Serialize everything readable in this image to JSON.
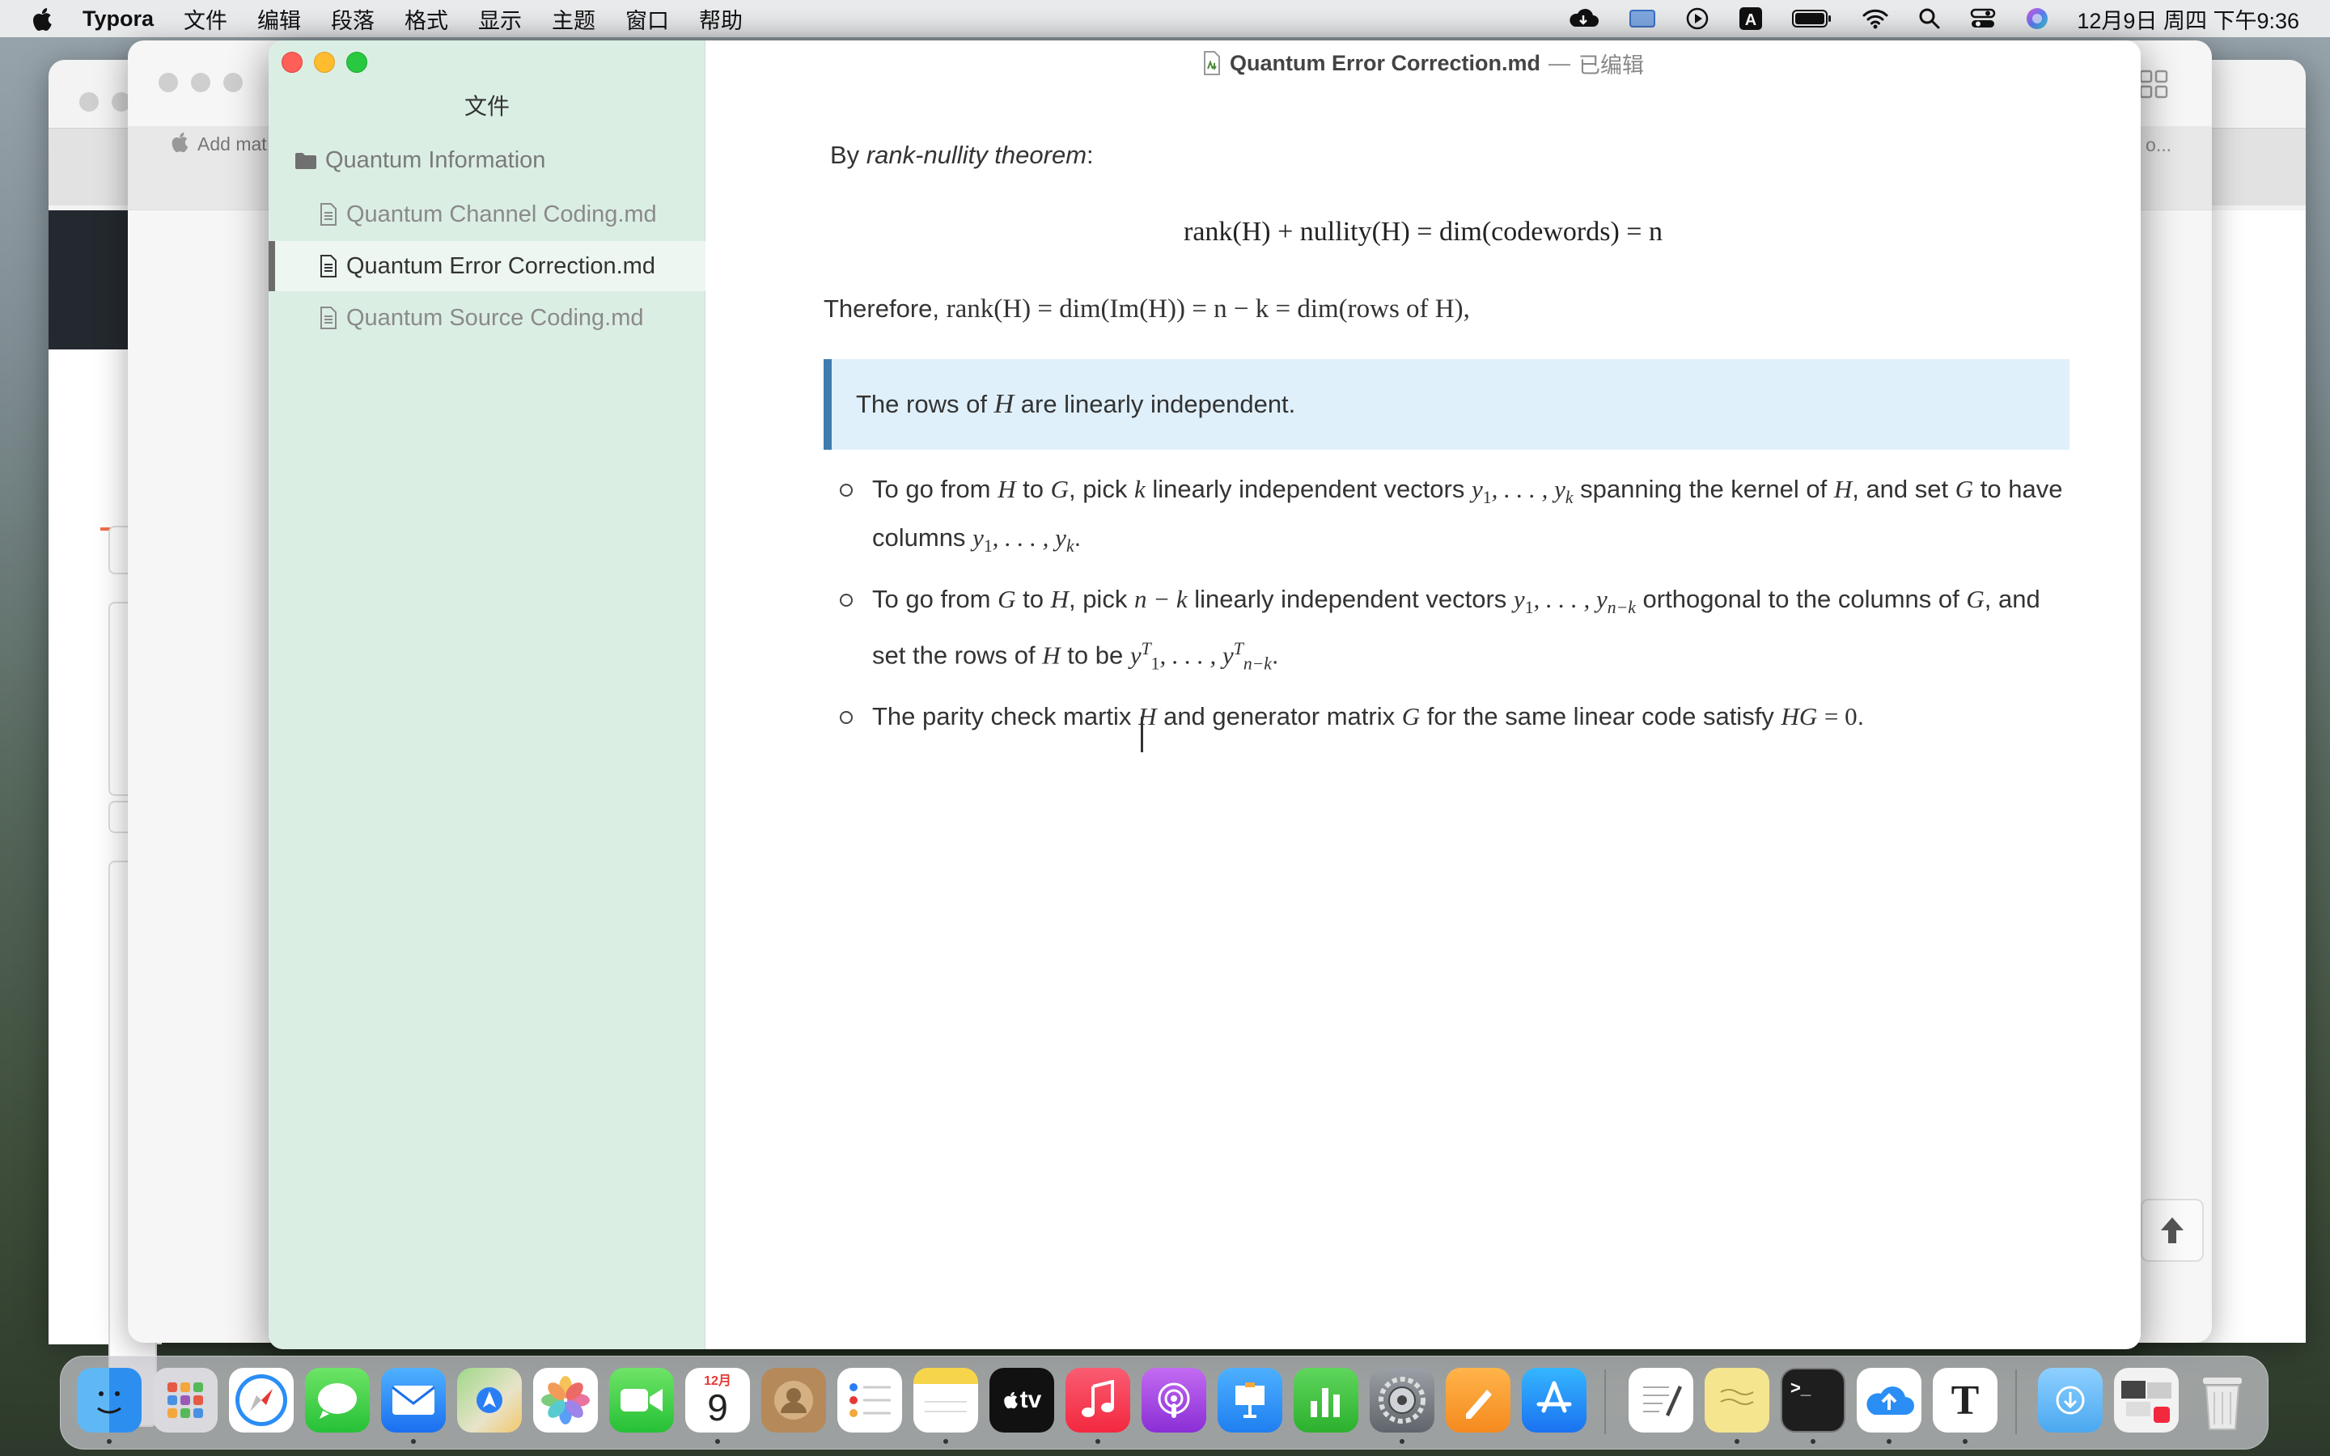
{
  "menubar": {
    "apple_icon": "apple-logo",
    "items": [
      "Typora",
      "文件",
      "编辑",
      "段落",
      "格式",
      "显示",
      "主题",
      "窗口",
      "帮助"
    ],
    "clock": "12月9日 周四 下午9:36",
    "status_icons": [
      "cloud-icon",
      "screen-icon",
      "play-icon",
      "input-method-icon",
      "battery-icon",
      "wifi-icon",
      "search-icon",
      "control-center-icon",
      "siri-icon"
    ],
    "input_method_label": "A"
  },
  "background_windows": {
    "browser_tab_text": "Add mat",
    "right_tab_text": "o..."
  },
  "typora": {
    "title_file": "Quantum Error Correction.md",
    "title_sep": "—",
    "title_state": "已编辑",
    "sidebar": {
      "title": "文件",
      "folder": "Quantum Information",
      "files": [
        "Quantum Channel Coding.md",
        "Quantum Error Correction.md",
        "Quantum Source Coding.md"
      ],
      "active_index": 1
    },
    "content": {
      "by": "By",
      "theorem": "rank-nullity theorem",
      "colon": ":",
      "display_eq": "rank(H) + nullity(H) = dim(codewords) = n",
      "therefore_prefix": "Therefore,",
      "therefore_eq": "rank(H) = dim(Im(H)) = n − k = dim(rows of H),",
      "blockquote_prefix": "The rows of",
      "blockquote_var": "H",
      "blockquote_suffix": "are linearly independent.",
      "bullets": [
        {
          "t1": "To go from",
          "m1": "H",
          "t2": "to",
          "m2": "G",
          "t3": ", pick",
          "m3": "k",
          "t4": "linearly independent vectors",
          "m4": "y",
          "s4": "1",
          "m4b": ", . . . , y",
          "s4b": "k",
          "t5": "spanning the kernel of",
          "m5": "H",
          "t6": ", and set",
          "m6": "G",
          "t7": "to have columns",
          "m7": "y",
          "s7": "1",
          "m7b": ", . . . , y",
          "s7b": "k",
          "t8": "."
        },
        {
          "t1": "To go from",
          "m1": "G",
          "t2": "to",
          "m2": "H",
          "t3": ", pick",
          "m3": "n − k",
          "t4": "linearly independent vectors",
          "m4": "y",
          "s4": "1",
          "m4b": ", . . . , y",
          "s4b": "n−k",
          "t5": "orthogonal to the columns of",
          "m5": "G",
          "t6": ", and set the rows of",
          "m6": "H",
          "t7": "to be",
          "m7": "y",
          "sup7": "T",
          "s7": "1",
          "m7b": ", . . . , y",
          "sup7b": "T",
          "s7b": "n−k",
          "t8": "."
        },
        {
          "t1": "The parity check martix",
          "m1": "H",
          "t2": "and generator matrix",
          "m2": "G",
          "t3": "for the same linear code satisfy",
          "m3": "HG",
          "m3b": "= 0",
          "t4": "."
        }
      ]
    }
  },
  "dock": {
    "apps": [
      "finder",
      "launchpad",
      "safari",
      "messages",
      "mail",
      "maps",
      "photos",
      "facetime",
      "calendar",
      "contacts",
      "reminders",
      "notes",
      "apple-tv",
      "music",
      "podcasts",
      "keynote",
      "numbers",
      "system-preferences",
      "pages",
      "app-store",
      "textedit",
      "stickies",
      "terminal",
      "icloud-upload",
      "typora",
      "downloads",
      "recent",
      "trash"
    ],
    "calendar_month": "12月",
    "calendar_day": "9",
    "tv_label": "tv",
    "typora_letter": "T",
    "terminal_prompt": ">_"
  }
}
